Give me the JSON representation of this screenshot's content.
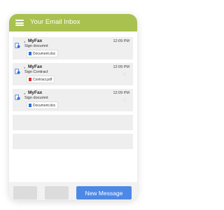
{
  "header": {
    "title": "Your Email Inbox",
    "menu_icon": "hamburger-menu-icon"
  },
  "colors": {
    "header_bg": "#a9c14f",
    "primary_button": "#4d88e6",
    "item_bg": "#efefef",
    "pdf_icon": "#d9342b",
    "doc_icon": "#2f6fd6"
  },
  "emails": [
    {
      "sender": "MyFax",
      "subject": "Sign documnt",
      "time": "12:09 PM",
      "attachment": {
        "name": "Document.doc",
        "type": "doc"
      }
    },
    {
      "sender": "MyFax",
      "subject": "Sign Contract",
      "time": "12:09 PM",
      "attachment": {
        "name": "Contract.pdf",
        "type": "pdf"
      }
    },
    {
      "sender": "MyFax",
      "subject": "Sign documnt",
      "time": "12:09 PM",
      "attachment": {
        "name": "Document.doc",
        "type": "doc"
      }
    }
  ],
  "footer": {
    "new_message_label": "New Message"
  }
}
